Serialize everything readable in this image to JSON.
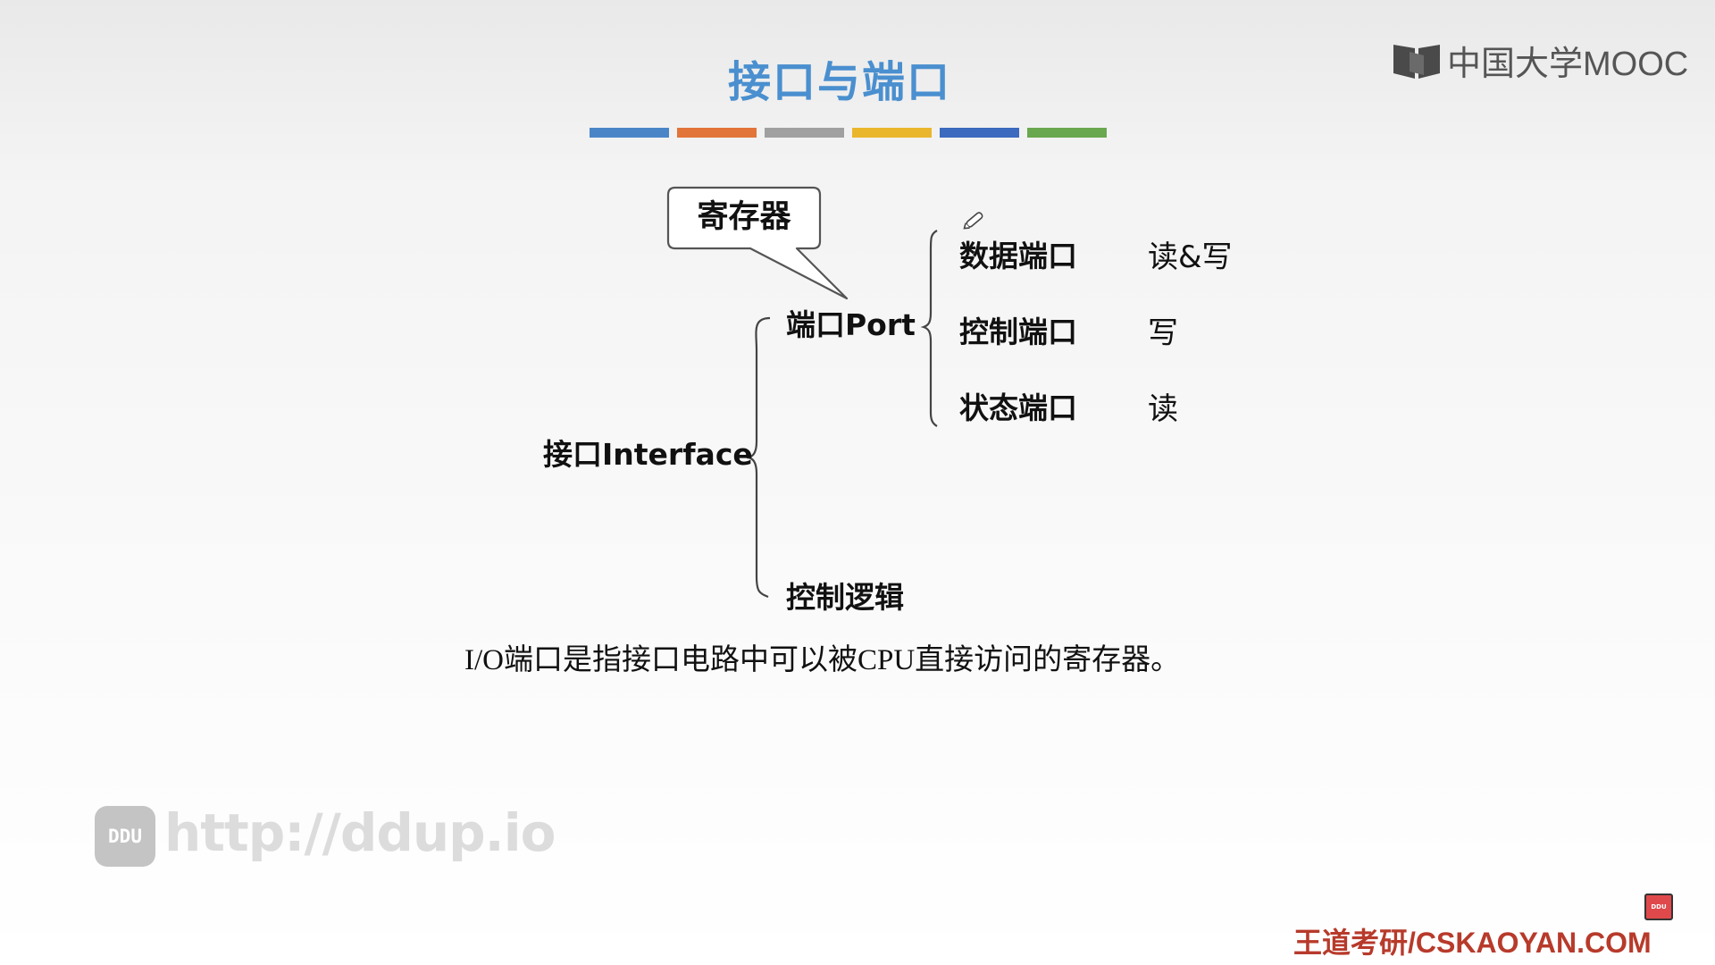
{
  "slide": {
    "title": "接口与端口",
    "accent_colors": [
      "#4a86c7",
      "#e2753a",
      "#a0a0a0",
      "#eab62c",
      "#3c6abf",
      "#6aa84f"
    ]
  },
  "branding": {
    "logo_label": "中国大学MOOC",
    "footer": "王道考研/CSKAOYAN.COM",
    "chip_label": "DDU"
  },
  "diagram": {
    "register_callout": "寄存器",
    "port": "端口Port",
    "interface": "接口Interface",
    "control_logic": "控制逻辑",
    "ports": [
      {
        "name": "数据端口",
        "access": "读&写"
      },
      {
        "name": "控制端口",
        "access": "写"
      },
      {
        "name": "状态端口",
        "access": "读"
      }
    ]
  },
  "statement": "I/O端口是指接口电路中可以被CPU直接访问的寄存器。",
  "watermark": {
    "badge": "DDU",
    "url": "http://ddup.io"
  }
}
